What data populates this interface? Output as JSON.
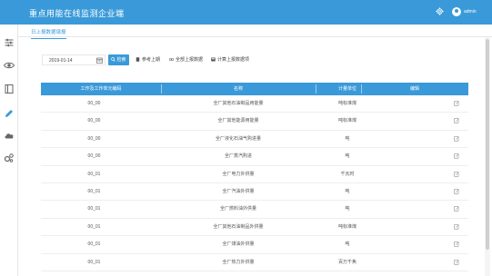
{
  "header": {
    "title": "重点用能在线监测企业端",
    "user": "admin"
  },
  "sidebar": {
    "icons": [
      "sliders-icon",
      "eye-icon",
      "book-icon",
      "pen-icon",
      "cloud-icon",
      "gears-icon"
    ],
    "active": "pen-icon"
  },
  "tabs": [
    {
      "label": "日上报数据填报",
      "active": true
    }
  ],
  "toolbar": {
    "date_value": "2019-01-14",
    "query_label": "检索",
    "reference_label": "参考上期",
    "upload_all_label": "全部上报数据",
    "calc_label": "计算上报数据项"
  },
  "table": {
    "columns": [
      "工作及工作单元编码",
      "名称",
      "计量单位",
      "编辑"
    ],
    "rows": [
      {
        "code": "00_00",
        "name": "全厂其他石油制品用能量",
        "unit": "吨标准煤"
      },
      {
        "code": "00_00",
        "name": "全厂其他能源用能量",
        "unit": "吨标准煤"
      },
      {
        "code": "00_00",
        "name": "全厂液化石油气购进量",
        "unit": "吨"
      },
      {
        "code": "00_00",
        "name": "全厂蒸汽购进",
        "unit": "吨"
      },
      {
        "code": "00_01",
        "name": "全厂电力外供量",
        "unit": "千瓦时"
      },
      {
        "code": "00_01",
        "name": "全厂汽油外供量",
        "unit": "吨"
      },
      {
        "code": "00_01",
        "name": "全厂燃料油外供量",
        "unit": "吨"
      },
      {
        "code": "00_01",
        "name": "全厂其他石油制品外供量",
        "unit": "吨标准煤"
      },
      {
        "code": "00_01",
        "name": "全厂煤油外供量",
        "unit": "吨"
      },
      {
        "code": "00_01",
        "name": "全厂热力外供量",
        "unit": "百万千焦"
      }
    ]
  },
  "colors": {
    "accent": "#3a9ad9",
    "sidebar_icon": "#666666"
  }
}
